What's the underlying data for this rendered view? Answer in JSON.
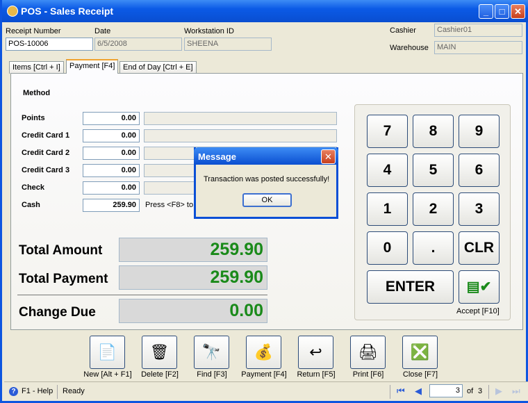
{
  "window": {
    "title": "POS - Sales Receipt"
  },
  "header": {
    "receipt_number_label": "Receipt Number",
    "receipt_number": "POS-10006",
    "date_label": "Date",
    "date": "6/5/2008",
    "workstation_label": "Workstation ID",
    "workstation": "SHEENA",
    "cashier_label": "Cashier",
    "cashier": "Cashier01",
    "warehouse_label": "Warehouse",
    "warehouse": "MAIN"
  },
  "tabs": [
    {
      "label": "Items [Ctrl + I]"
    },
    {
      "label": "Payment [F4]",
      "active": true
    },
    {
      "label": "End of Day [Ctrl + E]"
    }
  ],
  "payment": {
    "method_label": "Method",
    "rows": [
      {
        "label": "Points",
        "amount": "0.00",
        "detail": ""
      },
      {
        "label": "Credit Card 1",
        "amount": "0.00",
        "detail": ""
      },
      {
        "label": "Credit Card 2",
        "amount": "0.00",
        "detail": ""
      },
      {
        "label": "Credit Card 3",
        "amount": "0.00",
        "detail": ""
      },
      {
        "label": "Check",
        "amount": "0.00",
        "detail": ""
      },
      {
        "label": "Cash",
        "amount": "259.90",
        "detail": "Press <F8> to"
      }
    ],
    "total_amount_label": "Total Amount",
    "total_amount": "259.90",
    "total_payment_label": "Total Payment",
    "total_payment": "259.90",
    "change_due_label": "Change Due",
    "change_due": "0.00",
    "value_color": "#1a8a1a"
  },
  "keypad": {
    "keys": [
      "7",
      "8",
      "9",
      "4",
      "5",
      "6",
      "1",
      "2",
      "3",
      "0",
      ".",
      "CLR"
    ],
    "enter": "ENTER",
    "accept_label": "Accept [F10]"
  },
  "dialog": {
    "title": "Message",
    "message": "Transaction was posted successfully!",
    "ok": "OK"
  },
  "toolbar": [
    {
      "label": "New [Alt + F1]",
      "icon": "new-receipt-icon"
    },
    {
      "label": "Delete [F2]",
      "icon": "recycle-bin-icon"
    },
    {
      "label": "Find [F3]",
      "icon": "binoculars-icon"
    },
    {
      "label": "Payment [F4]",
      "icon": "payment-icon"
    },
    {
      "label": "Return [F5]",
      "icon": "return-icon"
    },
    {
      "label": "Print [F6]",
      "icon": "printer-icon"
    },
    {
      "label": "Close [F7]",
      "icon": "close-window-icon"
    }
  ],
  "status": {
    "help": "F1 - Help",
    "state": "Ready",
    "page": "3",
    "of_label": "of",
    "total_pages": "3"
  }
}
